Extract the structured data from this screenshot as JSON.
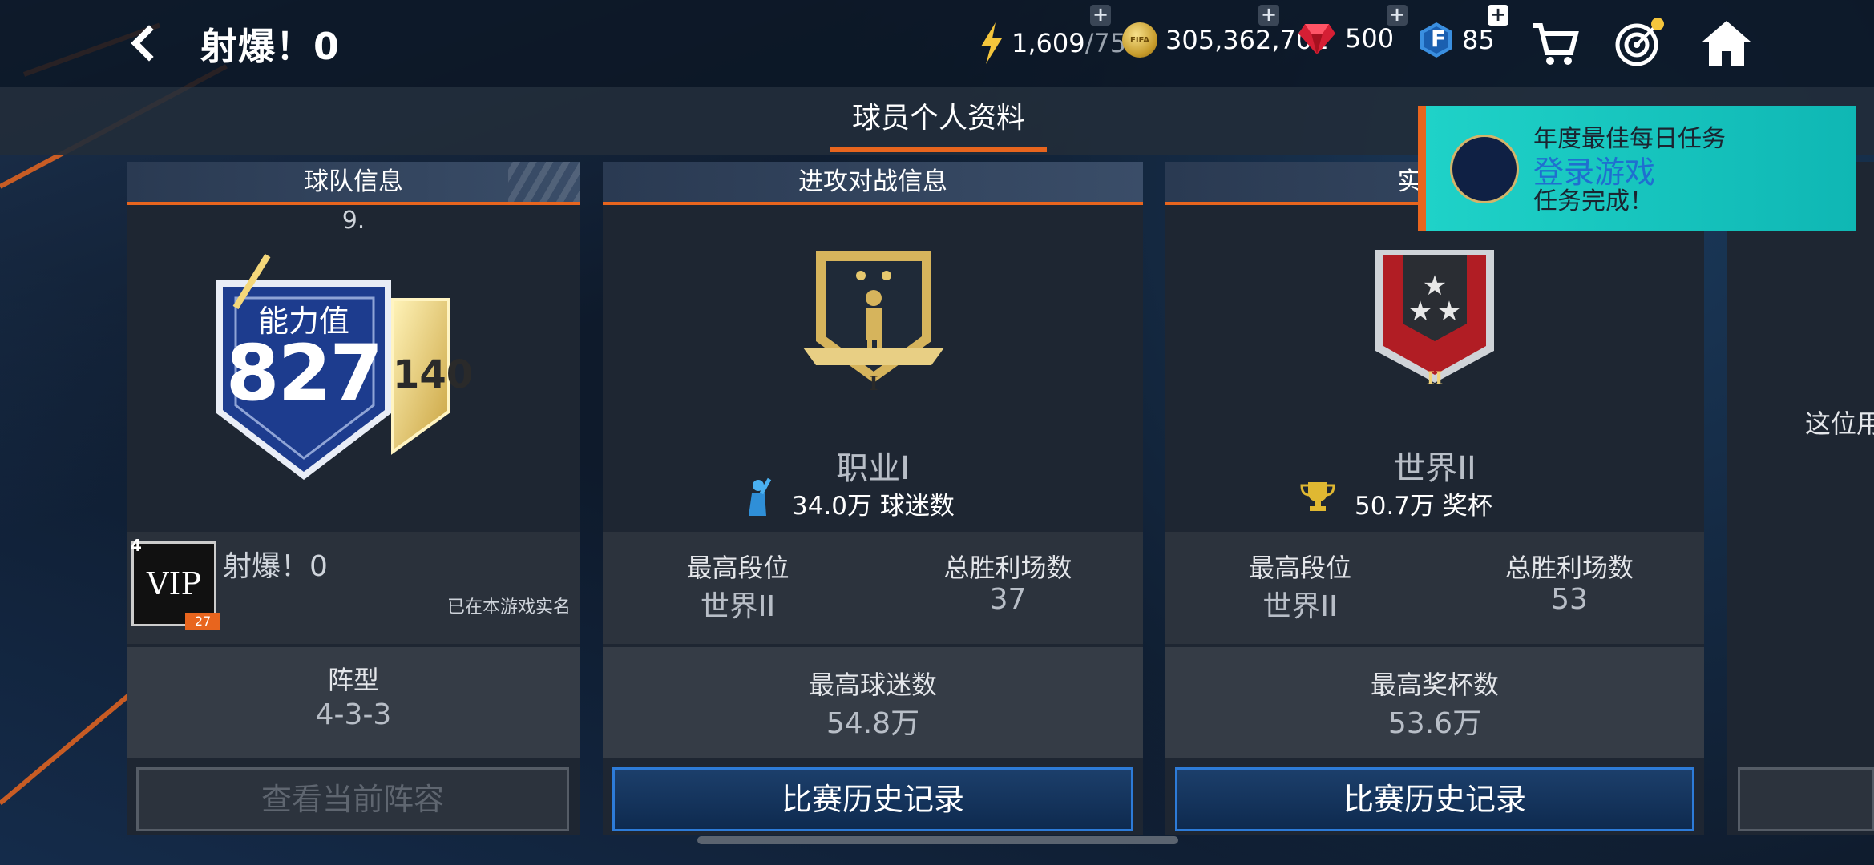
{
  "header": {
    "title": "射爆！0",
    "energy": "1,609",
    "energy_max": "/75",
    "coins": "305,362,701",
    "coin_label": "FIFA",
    "gems": "500",
    "fifa_points": "85",
    "fifa_points_letter": "F"
  },
  "tab": {
    "label": "球员个人资料"
  },
  "team_card": {
    "header": "球队信息",
    "rank_text": "9.",
    "rating_label": "能力值",
    "rating": "827",
    "badge_value": "140",
    "vip_text": "VIP",
    "vip_level": "4",
    "vip_points": "27",
    "player_name": "射爆！0",
    "verified_text": "已在本游戏实名",
    "formation_label": "阵型",
    "formation_value": "4-3-3",
    "view_lineup_button": "查看当前阵容"
  },
  "attack_card": {
    "header": "进攻对战信息",
    "badge_roman": "I",
    "division": "职业I",
    "fans_text": "34.0万 球迷数",
    "best_rank_label": "最高段位",
    "best_rank_value": "世界II",
    "total_wins_label": "总胜利场数",
    "total_wins_value": "37",
    "max_fans_label": "最高球迷数",
    "max_fans_value": "54.8万",
    "history_button": "比赛历史记录"
  },
  "realtime_card": {
    "header": "实时对",
    "badge_roman": "II",
    "division": "世界II",
    "trophies_text": "50.7万 奖杯",
    "best_rank_label": "最高段位",
    "best_rank_value": "世界II",
    "total_wins_label": "总胜利场数",
    "total_wins_value": "53",
    "max_trophies_label": "最高奖杯数",
    "max_trophies_value": "53.6万",
    "history_button": "比赛历史记录"
  },
  "partial_card": {
    "text": "这位用"
  },
  "notification": {
    "line1": "年度最佳每日任务",
    "line2": "登录游戏",
    "line3": "任务完成！"
  }
}
